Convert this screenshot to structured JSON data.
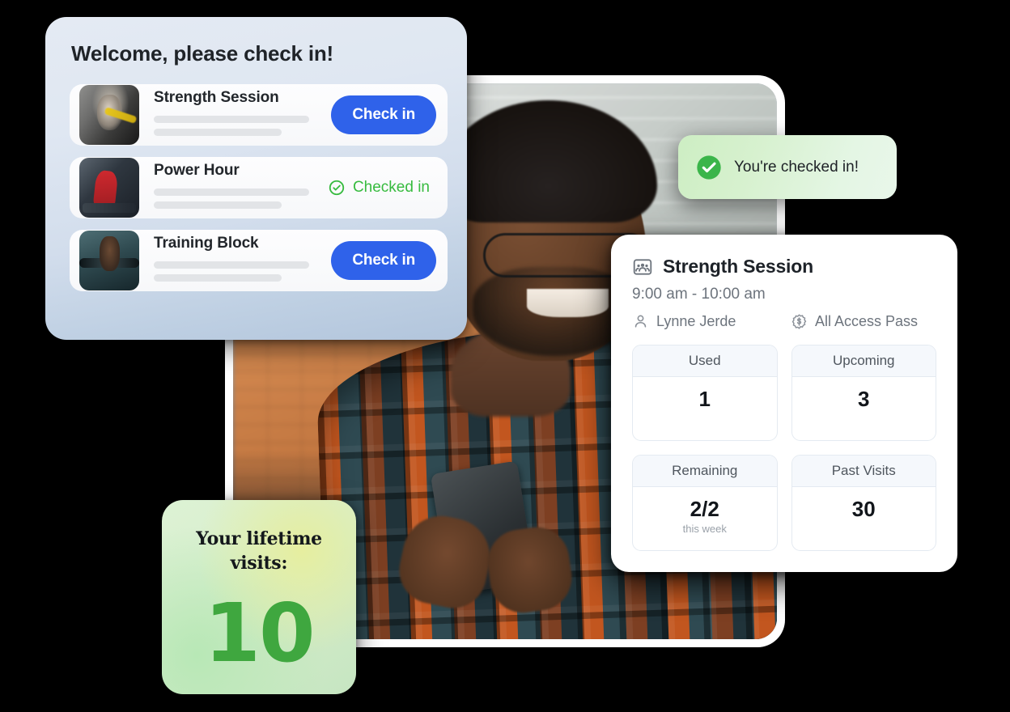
{
  "checkin_panel": {
    "title": "Welcome, please check in!",
    "sessions": [
      {
        "name": "Strength Session",
        "thumb": "gym-trx-athlete-thumbnail",
        "action_type": "button",
        "action_label": "Check in"
      },
      {
        "name": "Power Hour",
        "thumb": "gym-woman-machine-thumbnail",
        "action_type": "status",
        "action_label": "Checked in"
      },
      {
        "name": "Training Block",
        "thumb": "gym-barbell-deadlift-thumbnail",
        "action_type": "button",
        "action_label": "Check in"
      }
    ]
  },
  "toast": {
    "message": "You're checked in!",
    "icon": "check-circle-filled-icon"
  },
  "detail_card": {
    "icon": "group-class-icon",
    "title": "Strength Session",
    "time": "9:00 am - 10:00 am",
    "instructor": {
      "icon": "person-icon",
      "label": "Lynne Jerde"
    },
    "pass": {
      "icon": "dollar-badge-icon",
      "label": "All Access Pass"
    },
    "stats": [
      {
        "label": "Used",
        "value": "1",
        "sub": ""
      },
      {
        "label": "Upcoming",
        "value": "3",
        "sub": ""
      },
      {
        "label": "Remaining",
        "value": "2/2",
        "sub": "this week"
      },
      {
        "label": "Past Visits",
        "value": "30",
        "sub": ""
      }
    ]
  },
  "lifetime_card": {
    "title": "Your lifetime visits:",
    "value": "10"
  },
  "photo": {
    "alt": "smiling-man-with-glasses-using-phone"
  },
  "colors": {
    "primary_blue": "#2f62ea",
    "success_green": "#37bb3f",
    "lifetime_green": "#3fa73f",
    "panel_blue": "#dfe7f2",
    "toast_green": "#cdeec3"
  }
}
